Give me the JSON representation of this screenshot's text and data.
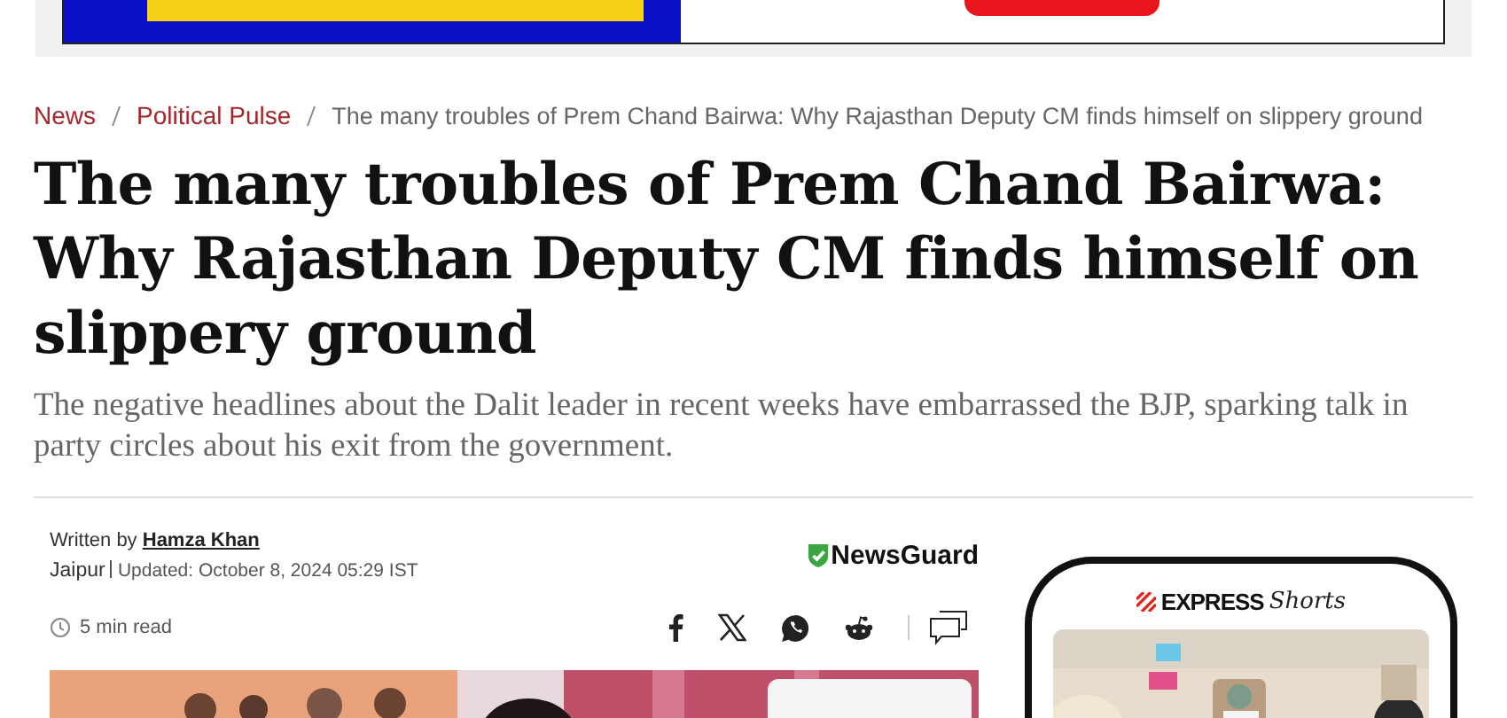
{
  "breadcrumb": [
    {
      "label": "News",
      "kind": "link"
    },
    {
      "label": "Political Pulse",
      "kind": "link"
    },
    {
      "label": "The many troubles of Prem Chand Bairwa: Why Rajasthan Deputy CM finds himself on slippery ground",
      "kind": "current"
    }
  ],
  "headline": "The many troubles of Prem Chand Bairwa: Why Rajasthan Deputy CM finds himself on slippery ground",
  "subheadline": "The negative headlines about the Dalit leader in recent weeks have embarrassed the BJP, sparking talk in party circles about his exit from the government.",
  "byline": {
    "prefix": "Written by",
    "author": "Hamza Khan",
    "location": "Jaipur",
    "updated": "Updated: October 8, 2024 05:29 IST",
    "read_time": "5 min read"
  },
  "newsguard": "NewsGuard",
  "share": [
    {
      "kind": "facebook"
    },
    {
      "kind": "x"
    },
    {
      "kind": "whatsapp"
    },
    {
      "kind": "reddit"
    },
    {
      "kind": "comments"
    }
  ],
  "shorts": {
    "brand": "EXPRESS",
    "title": "Shorts"
  }
}
